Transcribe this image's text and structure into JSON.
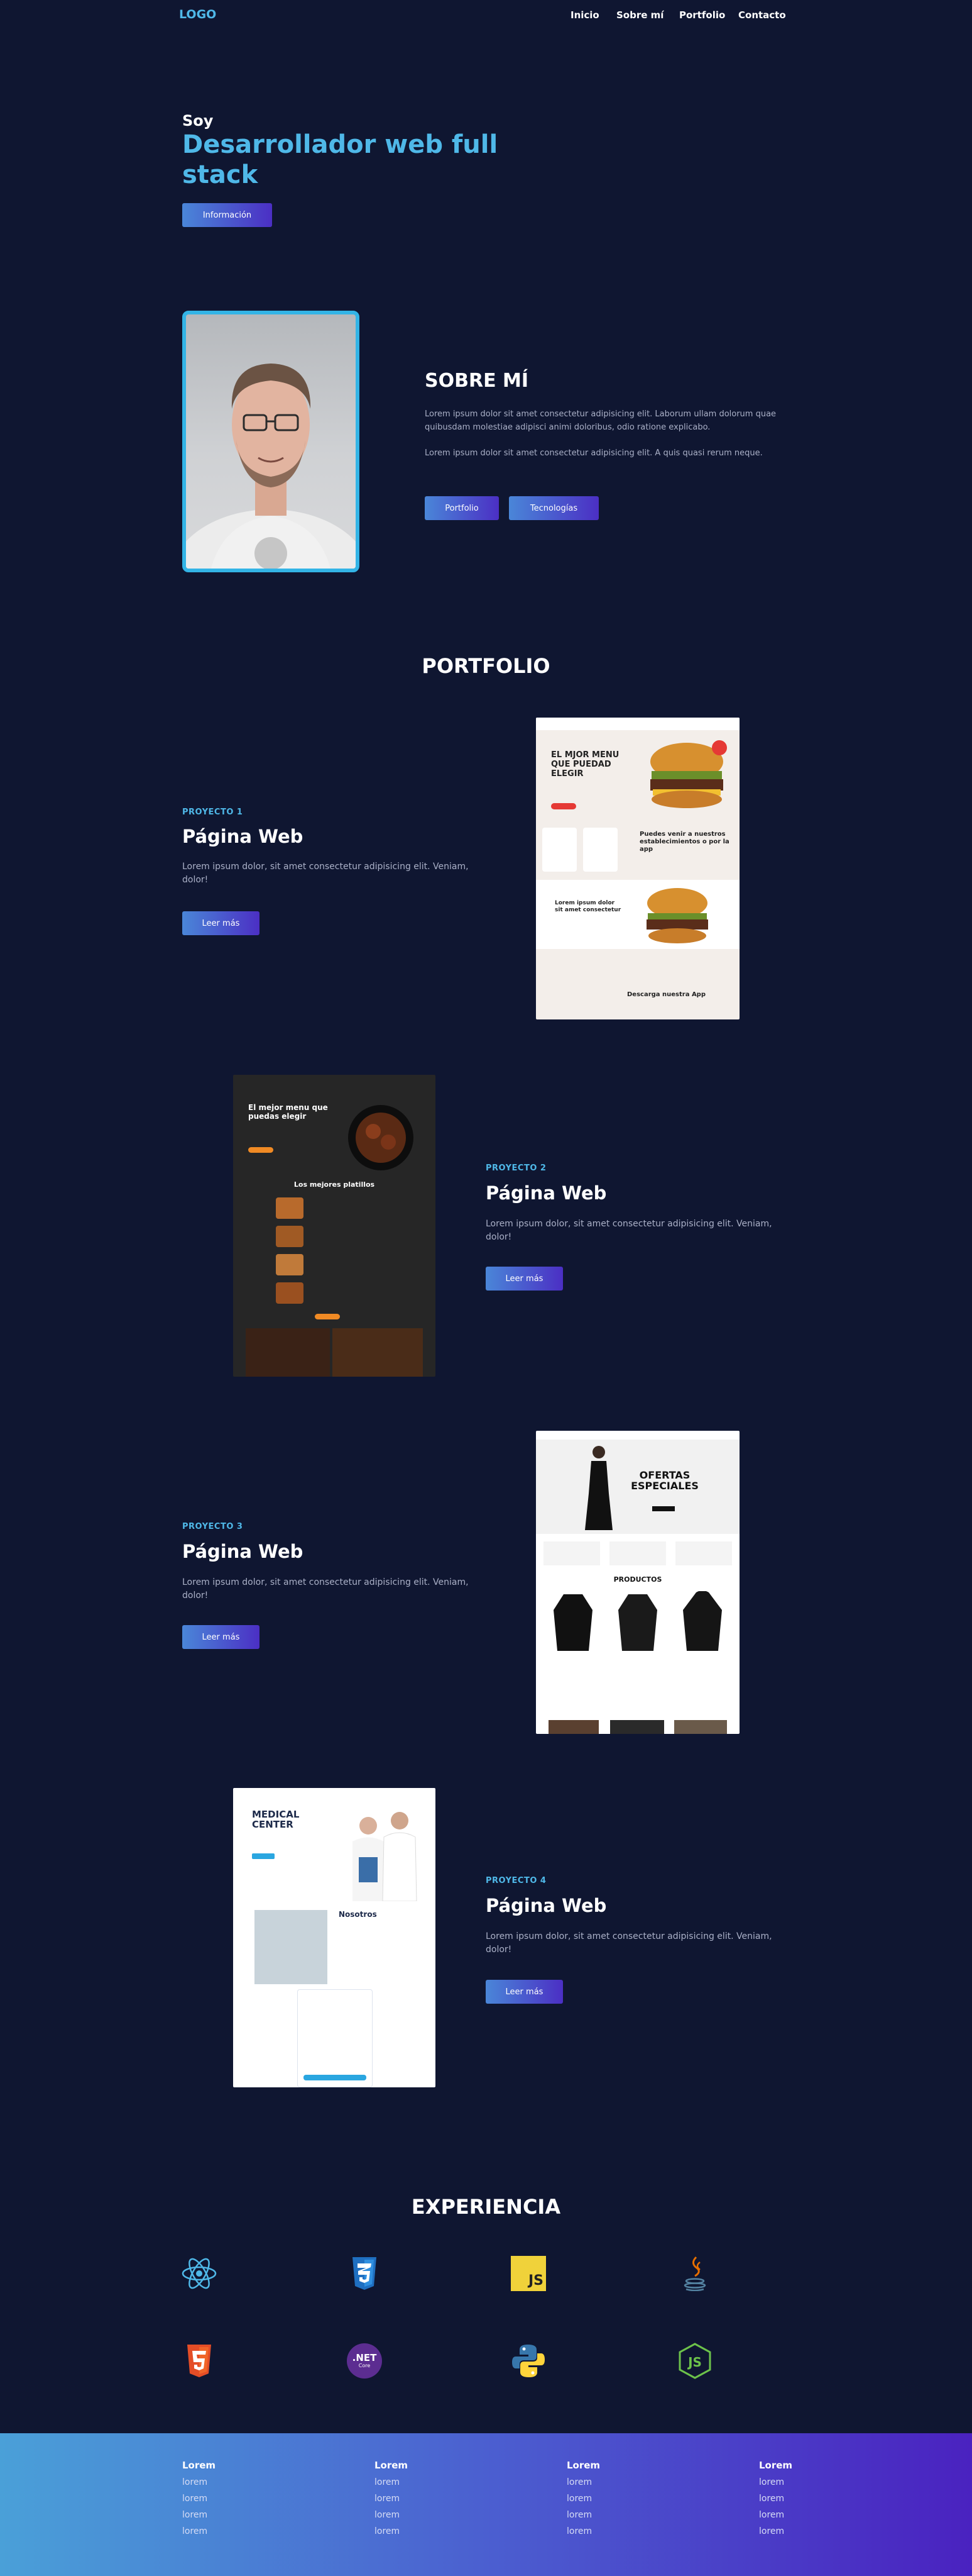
{
  "nav": {
    "logo": "LOGO",
    "links": [
      "Inicio",
      "Sobre mí",
      "Portfolio",
      "Contacto"
    ]
  },
  "hero": {
    "greeting": "Soy",
    "title": "Desarrollador web full stack",
    "button": "Información"
  },
  "about": {
    "title": "SOBRE MÍ",
    "p1": "Lorem ipsum dolor sit amet consectetur adipisicing elit. Laborum ullam dolorum quae quibusdam molestiae adipisci animi doloribus, odio ratione explicabo.",
    "p2": "Lorem ipsum dolor sit amet consectetur adipisicing elit. A quis quasi rerum neque.",
    "buttons": [
      "Portfolio",
      "Tecnologías"
    ]
  },
  "portfolio": {
    "title": "PORTFOLIO",
    "projects": [
      {
        "label": "PROYECTO 1",
        "title": "Página Web",
        "desc": "Lorem ipsum dolor, sit amet consectetur adipisicing elit. Veniam, dolor!",
        "button": "Leer más",
        "shot": {
          "heading": "EL MJOR MENU QUE PUEDAD ELEGIR",
          "sub1": "Puedes venir a nuestros establecimientos o por la app",
          "sub2": "Lorem ipsum dolor sit amet consectetur",
          "sub3": "Descarga nuestra App"
        }
      },
      {
        "label": "PROYECTO 2",
        "title": "Página Web",
        "desc": "Lorem ipsum dolor, sit amet consectetur adipisicing elit. Veniam, dolor!",
        "button": "Leer más",
        "shot": {
          "heading": "El mejor menu que puedas elegir",
          "sub1": "Los mejores platillos"
        }
      },
      {
        "label": "PROYECTO 3",
        "title": "Página Web",
        "desc": "Lorem ipsum dolor, sit amet consectetur adipisicing elit. Veniam, dolor!",
        "button": "Leer más",
        "shot": {
          "heading": "OFERTAS ESPECIALES",
          "sub1": "PRODUCTOS"
        }
      },
      {
        "label": "PROYECTO 4",
        "title": "Página Web",
        "desc": "Lorem ipsum dolor, sit amet consectetur adipisicing elit. Veniam, dolor!",
        "button": "Leer más",
        "shot": {
          "heading": "MEDICAL CENTER",
          "sub1": "Nosotros"
        }
      }
    ]
  },
  "experience": {
    "title": "EXPERIENCIA",
    "techs": [
      "react-icon",
      "css3-icon",
      "javascript-icon",
      "java-icon",
      "html5-icon",
      "dotnet-icon",
      "python-icon",
      "nodejs-icon"
    ],
    "dotnet_text": ".NET",
    "dotnet_sub": "Core",
    "js_text": "JS"
  },
  "footer": {
    "columns": [
      {
        "title": "Lorem",
        "links": [
          "lorem",
          "lorem",
          "lorem",
          "lorem"
        ]
      },
      {
        "title": "Lorem",
        "links": [
          "lorem",
          "lorem",
          "lorem",
          "lorem"
        ]
      },
      {
        "title": "Lorem",
        "links": [
          "lorem",
          "lorem",
          "lorem",
          "lorem"
        ]
      },
      {
        "title": "Lorem",
        "links": [
          "lorem",
          "lorem",
          "lorem",
          "lorem"
        ]
      }
    ]
  },
  "colors": {
    "background": "#0f1631",
    "accent": "#4fb8e8",
    "gradient_start": "#4a86d8",
    "gradient_end": "#4b2fc4"
  }
}
